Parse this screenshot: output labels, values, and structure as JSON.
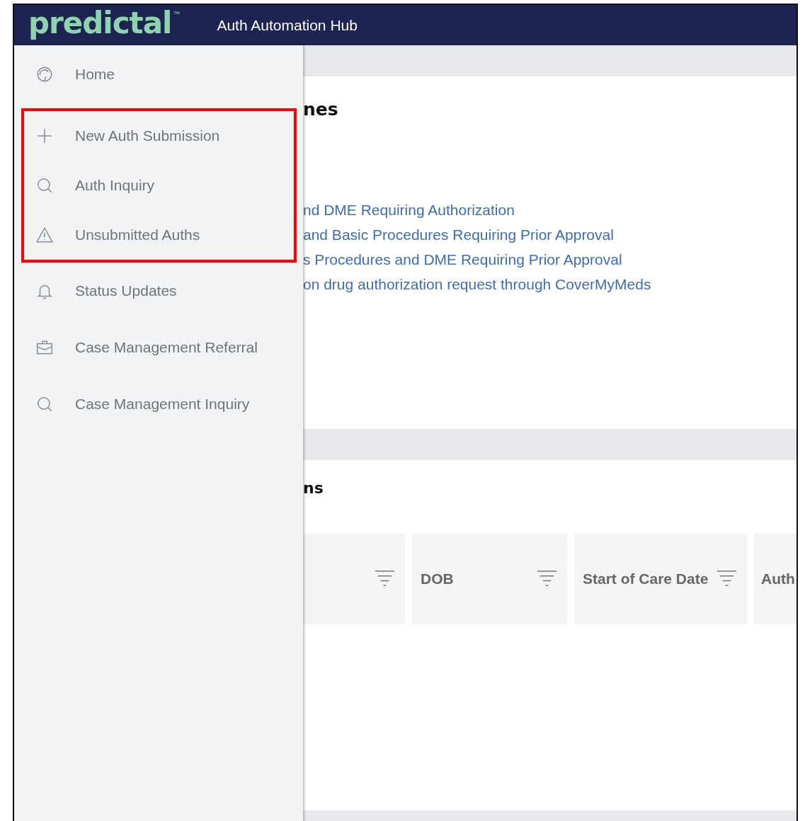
{
  "header": {
    "logo": "predictal",
    "logo_mark": "™",
    "title": "Auth Automation Hub"
  },
  "sidebar": {
    "items": [
      {
        "label": "Home",
        "kind": "gauge",
        "highlighted": false
      },
      {
        "label": "New Auth Submission",
        "kind": "plus",
        "highlighted": true
      },
      {
        "label": "Auth Inquiry",
        "kind": "search",
        "highlighted": true
      },
      {
        "label": "Unsubmitted Auths",
        "kind": "warning",
        "highlighted": true
      },
      {
        "label": "Status Updates",
        "kind": "bell",
        "highlighted": false
      },
      {
        "label": "Case Management Referral",
        "kind": "briefcase",
        "highlighted": false
      },
      {
        "label": "Case Management Inquiry",
        "kind": "search",
        "highlighted": false
      }
    ]
  },
  "sections": [
    {
      "heading": "nes",
      "links": [
        "nd DME Requiring Authorization",
        "and Basic Procedures Requiring Prior Approval",
        "s Procedures and DME Requiring Prior Approval",
        "on drug authorization request through CoverMyMeds"
      ]
    },
    {
      "heading": "ns",
      "table": {
        "columns": [
          {
            "filterable": true
          },
          {
            "label": "DOB",
            "filterable": true
          },
          {
            "label": "Start of Care Date",
            "filterable": true
          },
          {
            "label": "Auth"
          }
        ]
      }
    }
  ]
}
